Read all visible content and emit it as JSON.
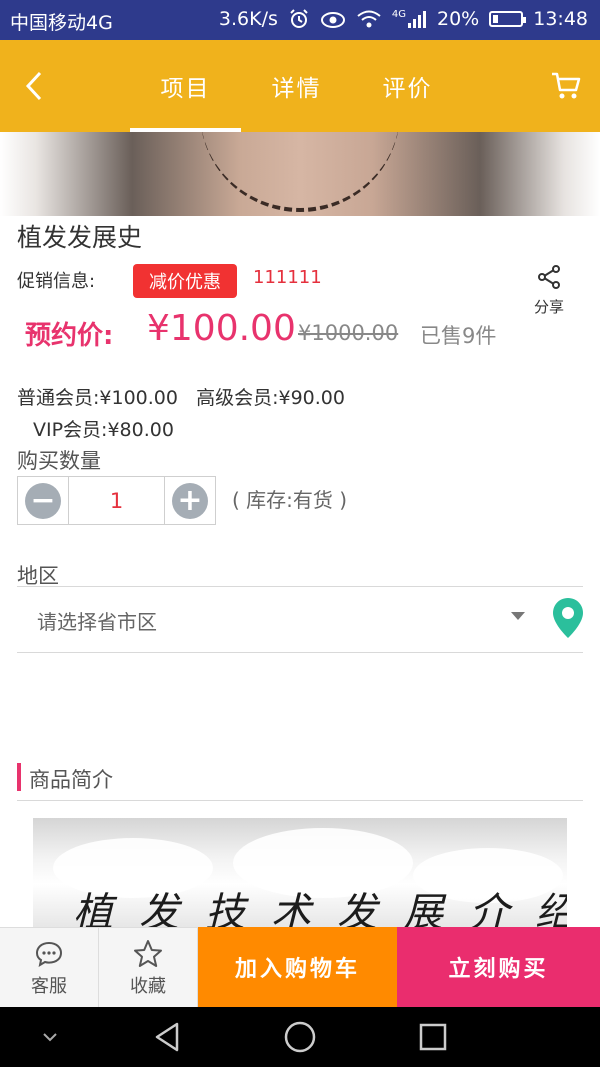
{
  "status_bar": {
    "carrier": "中国移动4G",
    "speed": "3.6K/s",
    "network": "4G",
    "battery_text": "20%",
    "battery_level": 0.2,
    "time": "13:48",
    "icons": [
      "alarm-icon",
      "eye-icon",
      "wifi-icon",
      "signal-icon",
      "battery-icon"
    ]
  },
  "header": {
    "back_icon": "chevron-left-icon",
    "tabs": [
      {
        "label": "项目",
        "active": true
      },
      {
        "label": "详情",
        "active": false
      },
      {
        "label": "评价",
        "active": false
      }
    ],
    "cart_icon": "cart-icon",
    "bg_color": "#f0b21c"
  },
  "product": {
    "title": "植发发展史",
    "promo_label": "促销信息:",
    "promo_badge": "减价优惠",
    "promo_code": "111111",
    "share_label": "分享",
    "preorder_label": "预约价:",
    "price": "¥100.00",
    "original_price": "¥1000.00",
    "sold": "已售9件",
    "member_prices_line1": "普通会员:¥100.00   高级会员:¥90.00",
    "member_prices_line2": "VIP会员:¥80.00"
  },
  "quantity": {
    "label": "购买数量",
    "value": "1",
    "minus": "−",
    "plus": "+",
    "stock": "( 库存:有货 )"
  },
  "region": {
    "label": "地区",
    "placeholder": "请选择省市区",
    "location_icon": "location-pin-icon"
  },
  "intro": {
    "section_title": "商品简介",
    "calligraphy": "植发技术发展介绍"
  },
  "bottom_bar": {
    "service_label": "客服",
    "favorite_label": "收藏",
    "add_cart_label": "加入购物车",
    "buy_now_label": "立刻购买"
  },
  "colors": {
    "accent_pink": "#e8336d",
    "promo_red": "#f13232",
    "add_cart_orange": "#ff8a00",
    "buy_now_pink": "#ea2d6e"
  }
}
